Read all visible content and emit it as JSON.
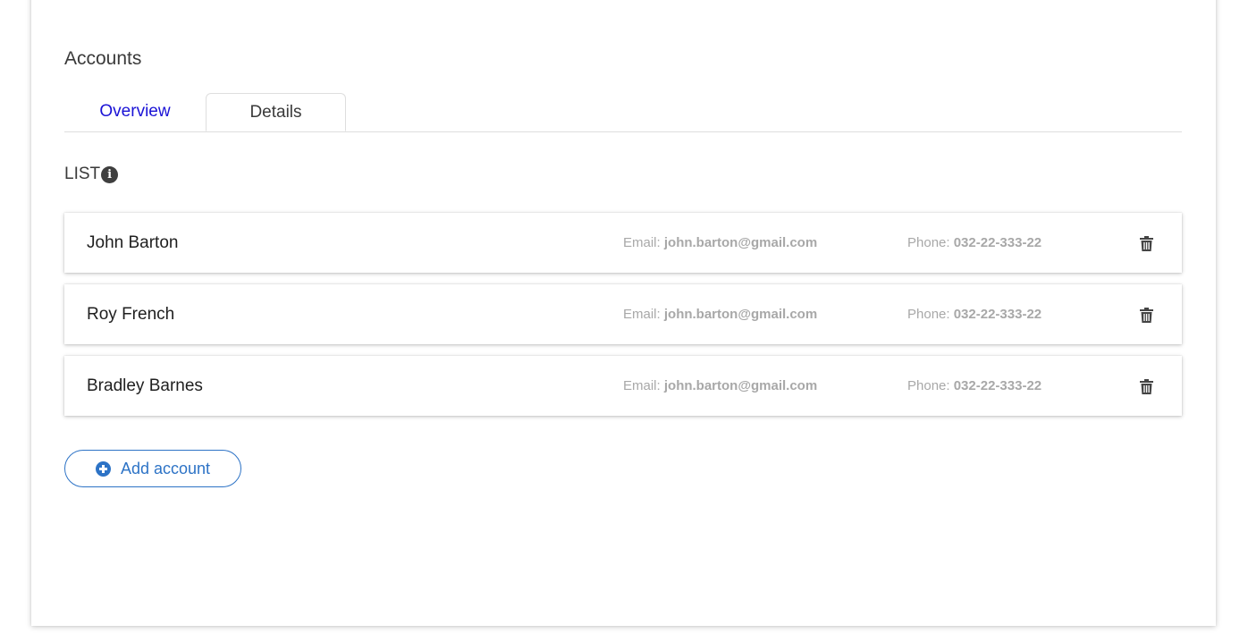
{
  "section": {
    "title": "Accounts"
  },
  "tabs": [
    {
      "label": "Overview",
      "active": false
    },
    {
      "label": "Details",
      "active": true
    }
  ],
  "list": {
    "label": "LIST",
    "info_icon": "info-circle-icon"
  },
  "accounts": [
    {
      "name": "John Barton",
      "email_label": "Email:",
      "email": "john.barton@gmail.com",
      "phone_label": "Phone:",
      "phone": "032-22-333-22"
    },
    {
      "name": "Roy French",
      "email_label": "Email:",
      "email": "john.barton@gmail.com",
      "phone_label": "Phone:",
      "phone": "032-22-333-22"
    },
    {
      "name": "Bradley Barnes",
      "email_label": "Email:",
      "email": "john.barton@gmail.com",
      "phone_label": "Phone:",
      "phone": "032-22-333-22"
    }
  ],
  "add_button": {
    "label": "Add account",
    "icon": "plus-circle-icon"
  },
  "colors": {
    "active_tab_link": "#1a12d6",
    "accent": "#2d73c6",
    "muted_text": "#a8a8a8"
  }
}
